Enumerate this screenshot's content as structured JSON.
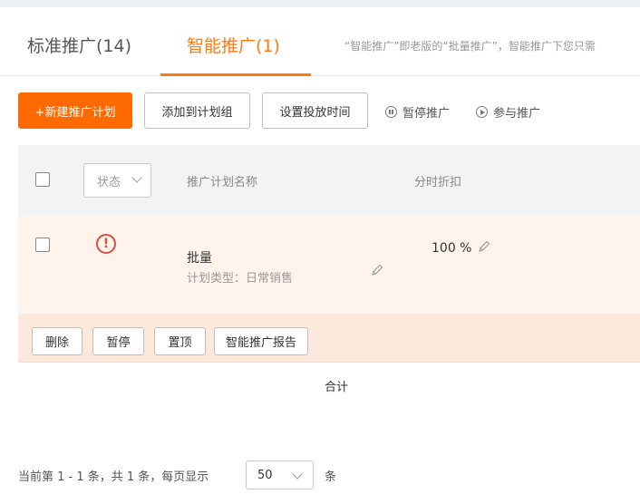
{
  "tabs": {
    "standard": "标准推广(14)",
    "smart": "智能推广(1)",
    "note": "“智能推广”即老版的“批量推广”，智能推广下您只需"
  },
  "toolbar": {
    "new_plan": "+新建推广计划",
    "add_to_group": "添加到计划组",
    "set_time": "设置投放时间",
    "pause": "暂停推广",
    "join": "参与推广"
  },
  "table": {
    "status_placeholder": "状态",
    "col_name": "推广计划名称",
    "col_discount": "分时折扣"
  },
  "row": {
    "name": "批量",
    "type": "计划类型：日常销售",
    "discount": "100 %"
  },
  "row_actions": {
    "delete": "删除",
    "pause": "暂停",
    "top": "置顶",
    "report": "智能推广报告"
  },
  "total": "合计",
  "pager": {
    "summary": "当前第 1 - 1 条，共 1 条，每页显示",
    "page_size": "50",
    "unit": "条"
  },
  "colors": {
    "accent": "#ff6a00",
    "row_bg": "#fef4ec",
    "actions_bg": "#fde9dc",
    "warning": "#e04a3f"
  }
}
